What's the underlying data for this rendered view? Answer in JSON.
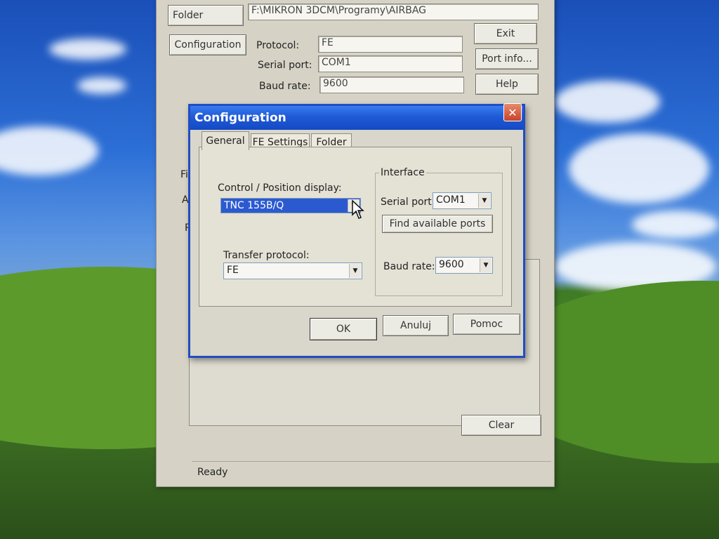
{
  "main_window": {
    "folder_button": "Folder",
    "folder_path": "F:\\MIKRON 3DCM\\Programy\\AIRBAG",
    "configuration_button": "Configuration",
    "protocol_label": "Protocol:",
    "protocol_value": "FE",
    "serial_port_label": "Serial port:",
    "serial_port_value": "COM1",
    "baud_rate_label": "Baud rate:",
    "baud_rate_value": "9600",
    "exit_button": "Exit",
    "port_info_button": "Port info...",
    "help_button": "Help",
    "partial_label_1": "Fil",
    "partial_label_2": "Ac",
    "partial_label_3": "Pr",
    "clear_button": "Clear",
    "status_text": "Ready"
  },
  "dialog": {
    "title": "Configuration",
    "close_glyph": "✕",
    "tabs": [
      {
        "label": "General",
        "active": true
      },
      {
        "label": "FE Settings",
        "active": false
      },
      {
        "label": "Folder",
        "active": false
      }
    ],
    "control_display_label": "Control / Position display:",
    "control_display_value": "TNC 155B/Q",
    "transfer_protocol_label": "Transfer protocol:",
    "transfer_protocol_value": "FE",
    "interface_group_label": "Interface",
    "serial_port_label": "Serial port:",
    "serial_port_value": "COM1",
    "find_ports_button": "Find available ports",
    "baud_rate_label": "Baud rate:",
    "baud_rate_value": "9600",
    "ok_button": "OK",
    "cancel_button": "Anuluj",
    "help_button": "Pomoc"
  },
  "icons": {
    "dropdown_arrow": "▼",
    "pointer": "mouse-pointer-icon"
  },
  "colors": {
    "titlebar": "#1f5ad6",
    "selection": "#2b5ad0",
    "close_button": "#c8432a",
    "window_face": "#d6d3c6"
  }
}
